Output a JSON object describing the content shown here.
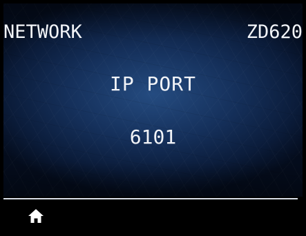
{
  "header": {
    "menu_title": "NETWORK",
    "model": "ZD620"
  },
  "setting": {
    "label": "IP PORT",
    "value": "6101"
  },
  "footer": {
    "home_icon": "home-icon"
  },
  "colors": {
    "background": "#000000",
    "panel_center": "#264e84",
    "panel_edge": "#0b1c3a",
    "text": "#f2f4f8",
    "divider": "#d8dde6"
  }
}
